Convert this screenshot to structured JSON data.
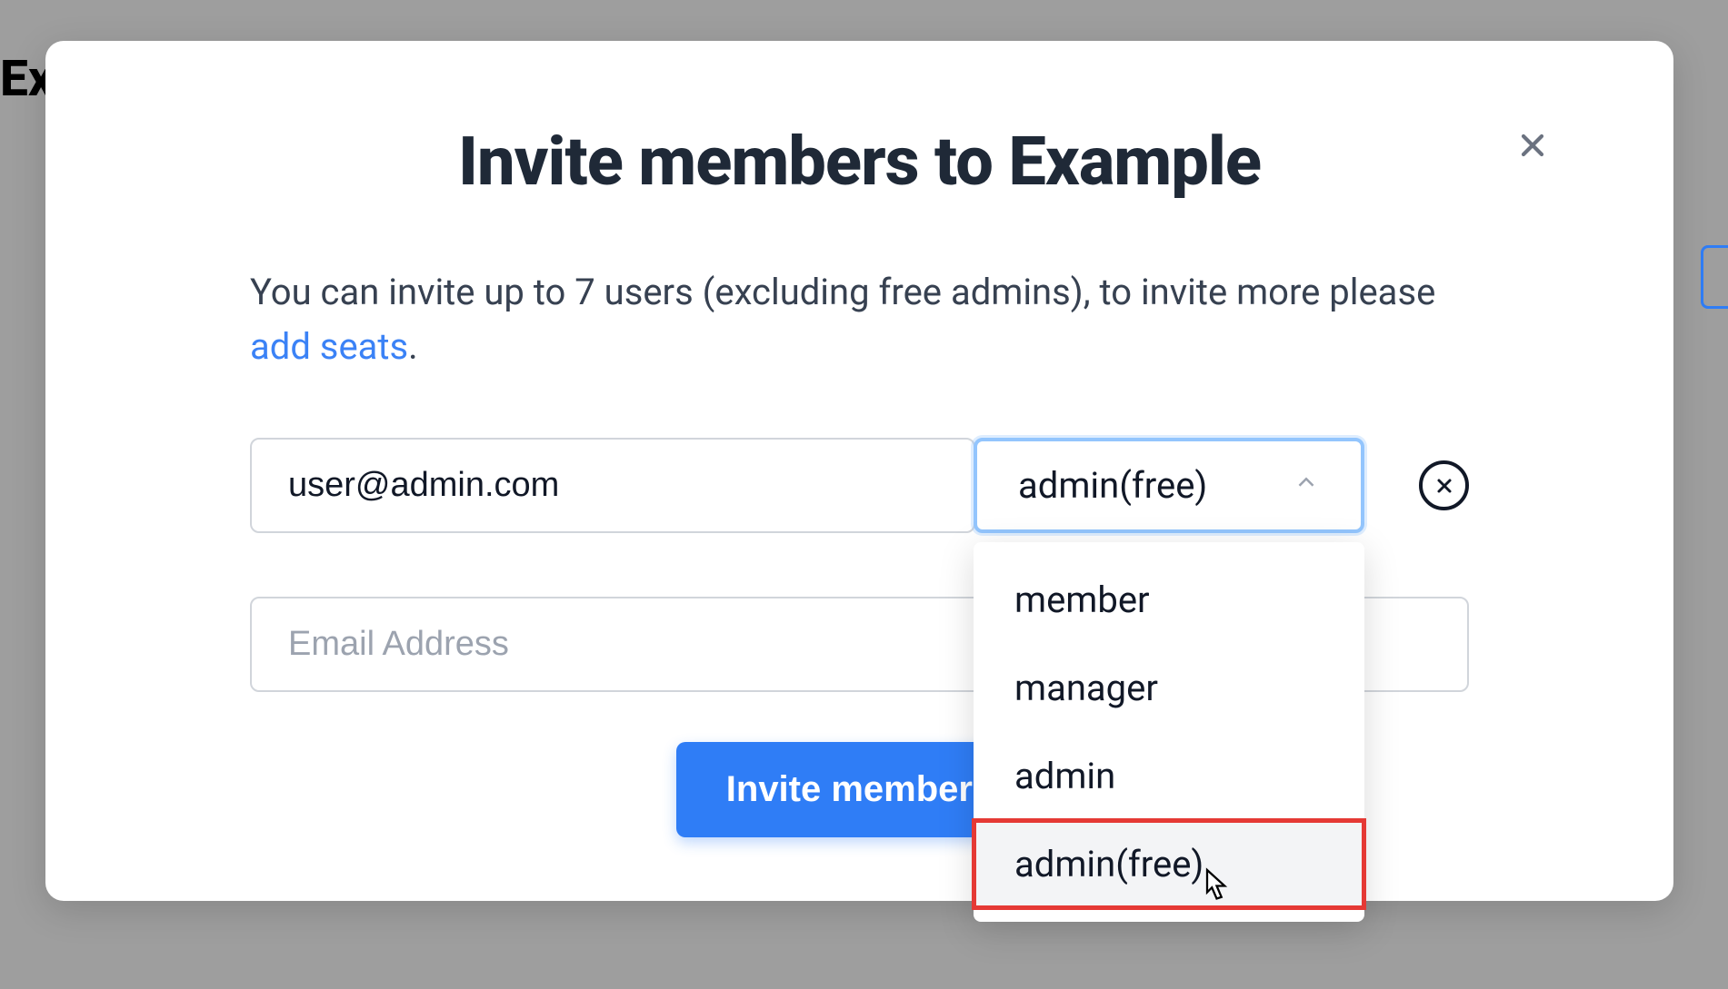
{
  "background": {
    "partial_text": "Ex"
  },
  "modal": {
    "title": "Invite members to Example",
    "description_prefix": "You can invite up to 7 users (excluding free admins), to invite more please ",
    "description_link": "add seats",
    "description_suffix": ".",
    "rows": [
      {
        "email_value": "user@admin.com",
        "role_selected": "admin(free)"
      },
      {
        "email_placeholder": "Email Address"
      }
    ],
    "role_options": [
      "member",
      "manager",
      "admin",
      "admin(free)"
    ],
    "submit_label": "Invite members"
  }
}
